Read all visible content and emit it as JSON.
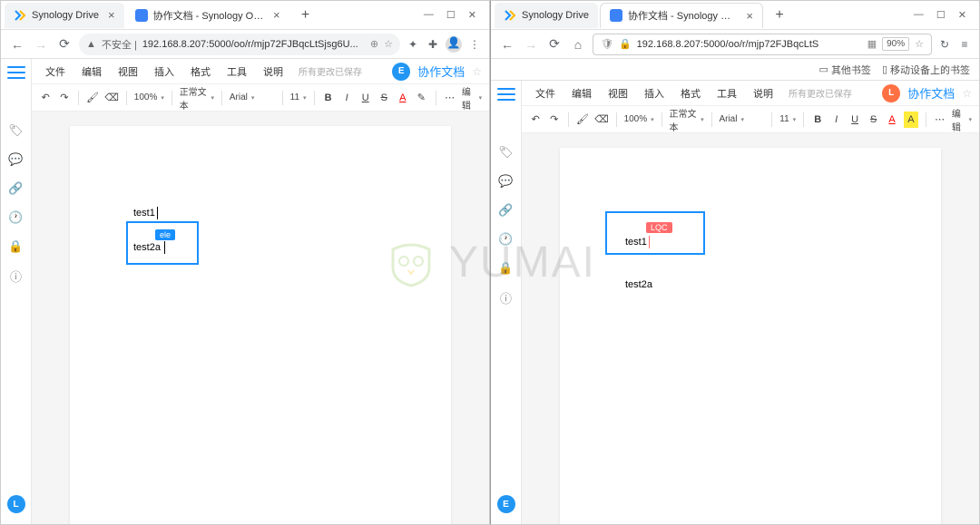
{
  "left": {
    "tabs": [
      {
        "title": "Synology Drive"
      },
      {
        "title": "协作文档 - Synology Office 文"
      }
    ],
    "url_prefix": "不安全 |",
    "url": "192.168.8.207:5000/oo/r/mjp72FJBqcLtSjsg6U...",
    "menus": [
      "文件",
      "编辑",
      "视图",
      "插入",
      "格式",
      "工具",
      "说明"
    ],
    "save_status": "所有更改已保存",
    "doc_title": "协作文档",
    "avatar": "E",
    "zoom": "100%",
    "style": "正常文本",
    "font": "Arial",
    "size": "11",
    "mode": "编辑",
    "text1": "test1",
    "text2": "test2a",
    "collab_tag": "ele"
  },
  "right": {
    "tabs": [
      {
        "title": "Synology Drive"
      },
      {
        "title": "协作文档 - Synology Office 文"
      }
    ],
    "url": "192.168.8.207:5000/oo/r/mjp72FJBqcLtS",
    "zoom_badge": "90%",
    "bookmarks": {
      "other": "其他书签",
      "mobile": "移动设备上的书签"
    },
    "menus": [
      "文件",
      "编辑",
      "视图",
      "插入",
      "格式",
      "工具",
      "说明"
    ],
    "save_status": "所有更改已保存",
    "doc_title": "协作文档",
    "avatar": "L",
    "zoom": "100%",
    "style": "正常文本",
    "font": "Arial",
    "size": "11",
    "mode": "编辑",
    "text1": "test1",
    "text2": "test2a",
    "collab_tag": "LQC"
  },
  "watermark": "YUMAI",
  "bottom_avatar": "L"
}
